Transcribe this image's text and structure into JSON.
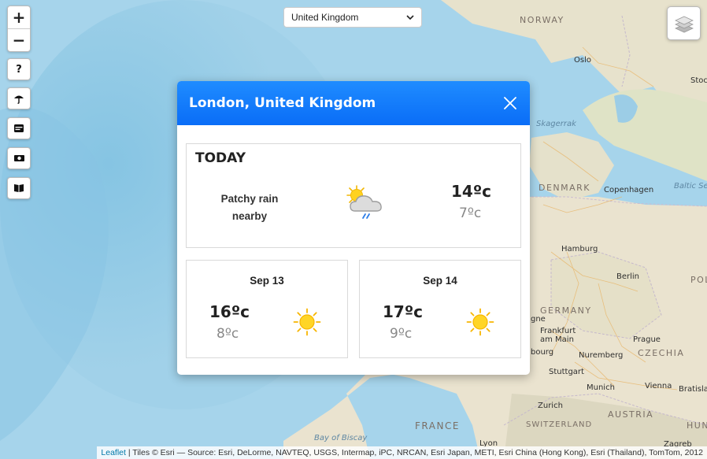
{
  "map": {
    "labels": {
      "norway": "NORWAY",
      "oslo": "Oslo",
      "stockholm": "Stoc",
      "skagerrak": "Skagerrak",
      "denmark": "DENMARK",
      "copenhagen": "Copenhagen",
      "baltic": "Baltic Se",
      "hamburg": "Hamburg",
      "berlin": "Berlin",
      "poland": "POL",
      "germany": "GERMANY",
      "frankfurt": "Frankfurt am Main",
      "prague": "Prague",
      "czechia": "CZECHIA",
      "nuremberg": "Nuremberg",
      "stuttgart": "Stuttgart",
      "munich": "Munich",
      "vienna": "Vienna",
      "bratislava": "Bratisla",
      "zurich": "Zurich",
      "austria": "AUSTRIA",
      "france": "FRANCE",
      "switzerland": "SWITZERLAND",
      "bay_of_biscay": "Bay of Biscay",
      "ourg": "bourg",
      "gne": "gne",
      "lyon": "Lyon",
      "hun": "HUN",
      "zagreb": "Zagreb"
    }
  },
  "controls": {
    "zoom_in": "+",
    "zoom_out": "−",
    "help": "?",
    "icons": [
      "help-icon",
      "umbrella-icon",
      "card-icon",
      "money-icon",
      "book-icon",
      "layers-icon"
    ]
  },
  "country_select": {
    "value": "United Kingdom"
  },
  "modal": {
    "title": "London, United Kingdom",
    "today": {
      "label": "TODAY",
      "condition": "Patchy rain nearby",
      "high": "14ºc",
      "low": "7ºc",
      "icon": "partly-cloudy-rain-icon"
    },
    "forecast": [
      {
        "date": "Sep 13",
        "high": "16ºc",
        "low": "8ºc",
        "icon": "sun-icon"
      },
      {
        "date": "Sep 14",
        "high": "17ºc",
        "low": "9ºc",
        "icon": "sun-icon"
      }
    ]
  },
  "attribution": {
    "link": "Leaflet",
    "text": " | Tiles © Esri — Source: Esri, DeLorme, NAVTEQ, USGS, Intermap, iPC, NRCAN, Esri Japan, METI, Esri China (Hong Kong), Esri (Thailand), TomTom, 2012"
  },
  "colors": {
    "header": "#1479fa",
    "sea": "#a9d6ec",
    "land": "#e8e4cf"
  }
}
